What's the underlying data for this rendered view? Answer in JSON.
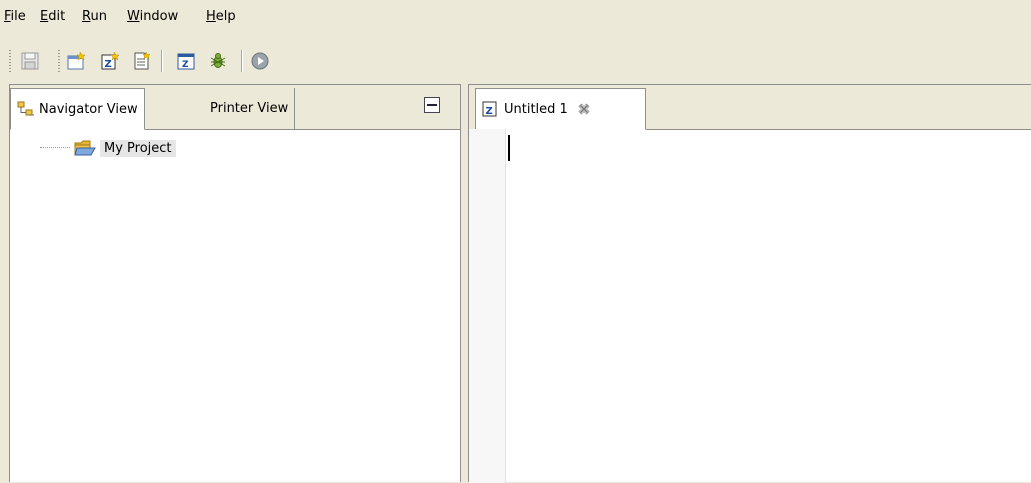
{
  "menubar": {
    "items": [
      {
        "mnemonic": "F",
        "rest": "ile"
      },
      {
        "mnemonic": "E",
        "rest": "dit"
      },
      {
        "mnemonic": "R",
        "rest": "un"
      },
      {
        "mnemonic": "W",
        "rest": "indow"
      },
      {
        "mnemonic": "H",
        "rest": "elp"
      }
    ]
  },
  "toolbar": {
    "buttons": [
      "save-icon",
      "new-project-icon",
      "new-file-icon",
      "new-document-icon",
      "zend-editor-icon",
      "debug-bug-icon",
      "run-icon"
    ]
  },
  "left_panel": {
    "tabs": [
      {
        "label": "Navigator View",
        "icon": "navigator-tree-icon",
        "active": true
      },
      {
        "label": "Printer View",
        "active": false
      }
    ],
    "tree": [
      {
        "label": "My Project",
        "icon": "open-folder-icon"
      }
    ]
  },
  "editor": {
    "tabs": [
      {
        "label": "Untitled 1",
        "icon": "zend-file-icon",
        "close_icon": "close-icon"
      }
    ]
  },
  "colors": {
    "chrome": "#ece9d8",
    "border": "#8f8f8f",
    "selection": "#e6e6e6"
  }
}
